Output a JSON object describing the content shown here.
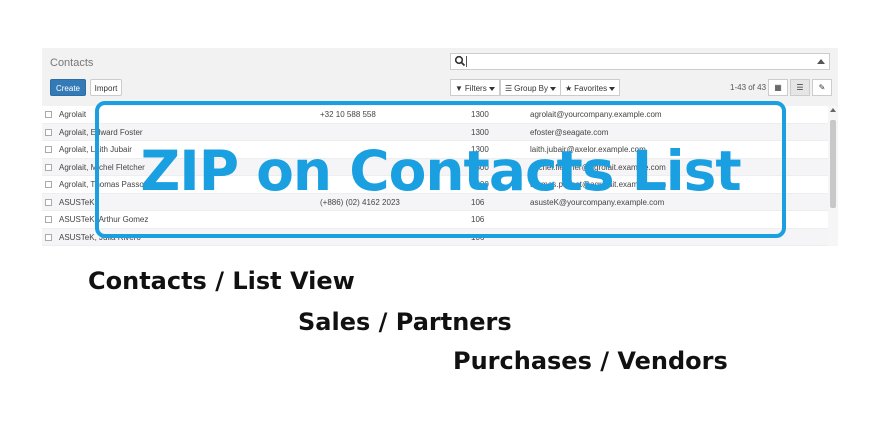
{
  "control_panel": {
    "breadcrumb": "Contacts",
    "search_value": "",
    "create_label": "Create",
    "import_label": "Import",
    "filters_label": "Filters",
    "group_by_label": "Group By",
    "favorites_label": "Favorites",
    "pager": "1-43 of 43"
  },
  "rows": [
    {
      "name": "Agrolait",
      "phone": "+32 10 588 558",
      "zip": "1300",
      "email": "agrolait@yourcompany.example.com"
    },
    {
      "name": "Agrolait, Edward Foster",
      "phone": "",
      "zip": "1300",
      "email": "efoster@seagate.com"
    },
    {
      "name": "Agrolait, Laith Jubair",
      "phone": "",
      "zip": "1300",
      "email": "laith.jubair@axelor.example.com"
    },
    {
      "name": "Agrolait, Michel Fletcher",
      "phone": "",
      "zip": "1300",
      "email": "michel.fletcher@agrolait.example.com"
    },
    {
      "name": "Agrolait, Thomas Passot",
      "phone": "",
      "zip": "1300",
      "email": "thomas.passot@agrolait.example.com"
    },
    {
      "name": "ASUSTeK",
      "phone": "(+886) (02) 4162 2023",
      "zip": "106",
      "email": "asusteK@yourcompany.example.com"
    },
    {
      "name": "ASUSTeK, Arthur Gomez",
      "phone": "",
      "zip": "106",
      "email": ""
    },
    {
      "name": "ASUSTeK, Julia Rivero",
      "phone": "",
      "zip": "106",
      "email": ""
    }
  ],
  "overlay": {
    "title": "ZIP on Contacts List",
    "color": "#1aa0e0"
  },
  "captions": {
    "line1": "Contacts / List View",
    "line2": "Sales / Partners",
    "line3": "Purchases / Vendors"
  },
  "colors": {
    "primary_button": "#337ab7",
    "accent": "#1aa0e0"
  }
}
